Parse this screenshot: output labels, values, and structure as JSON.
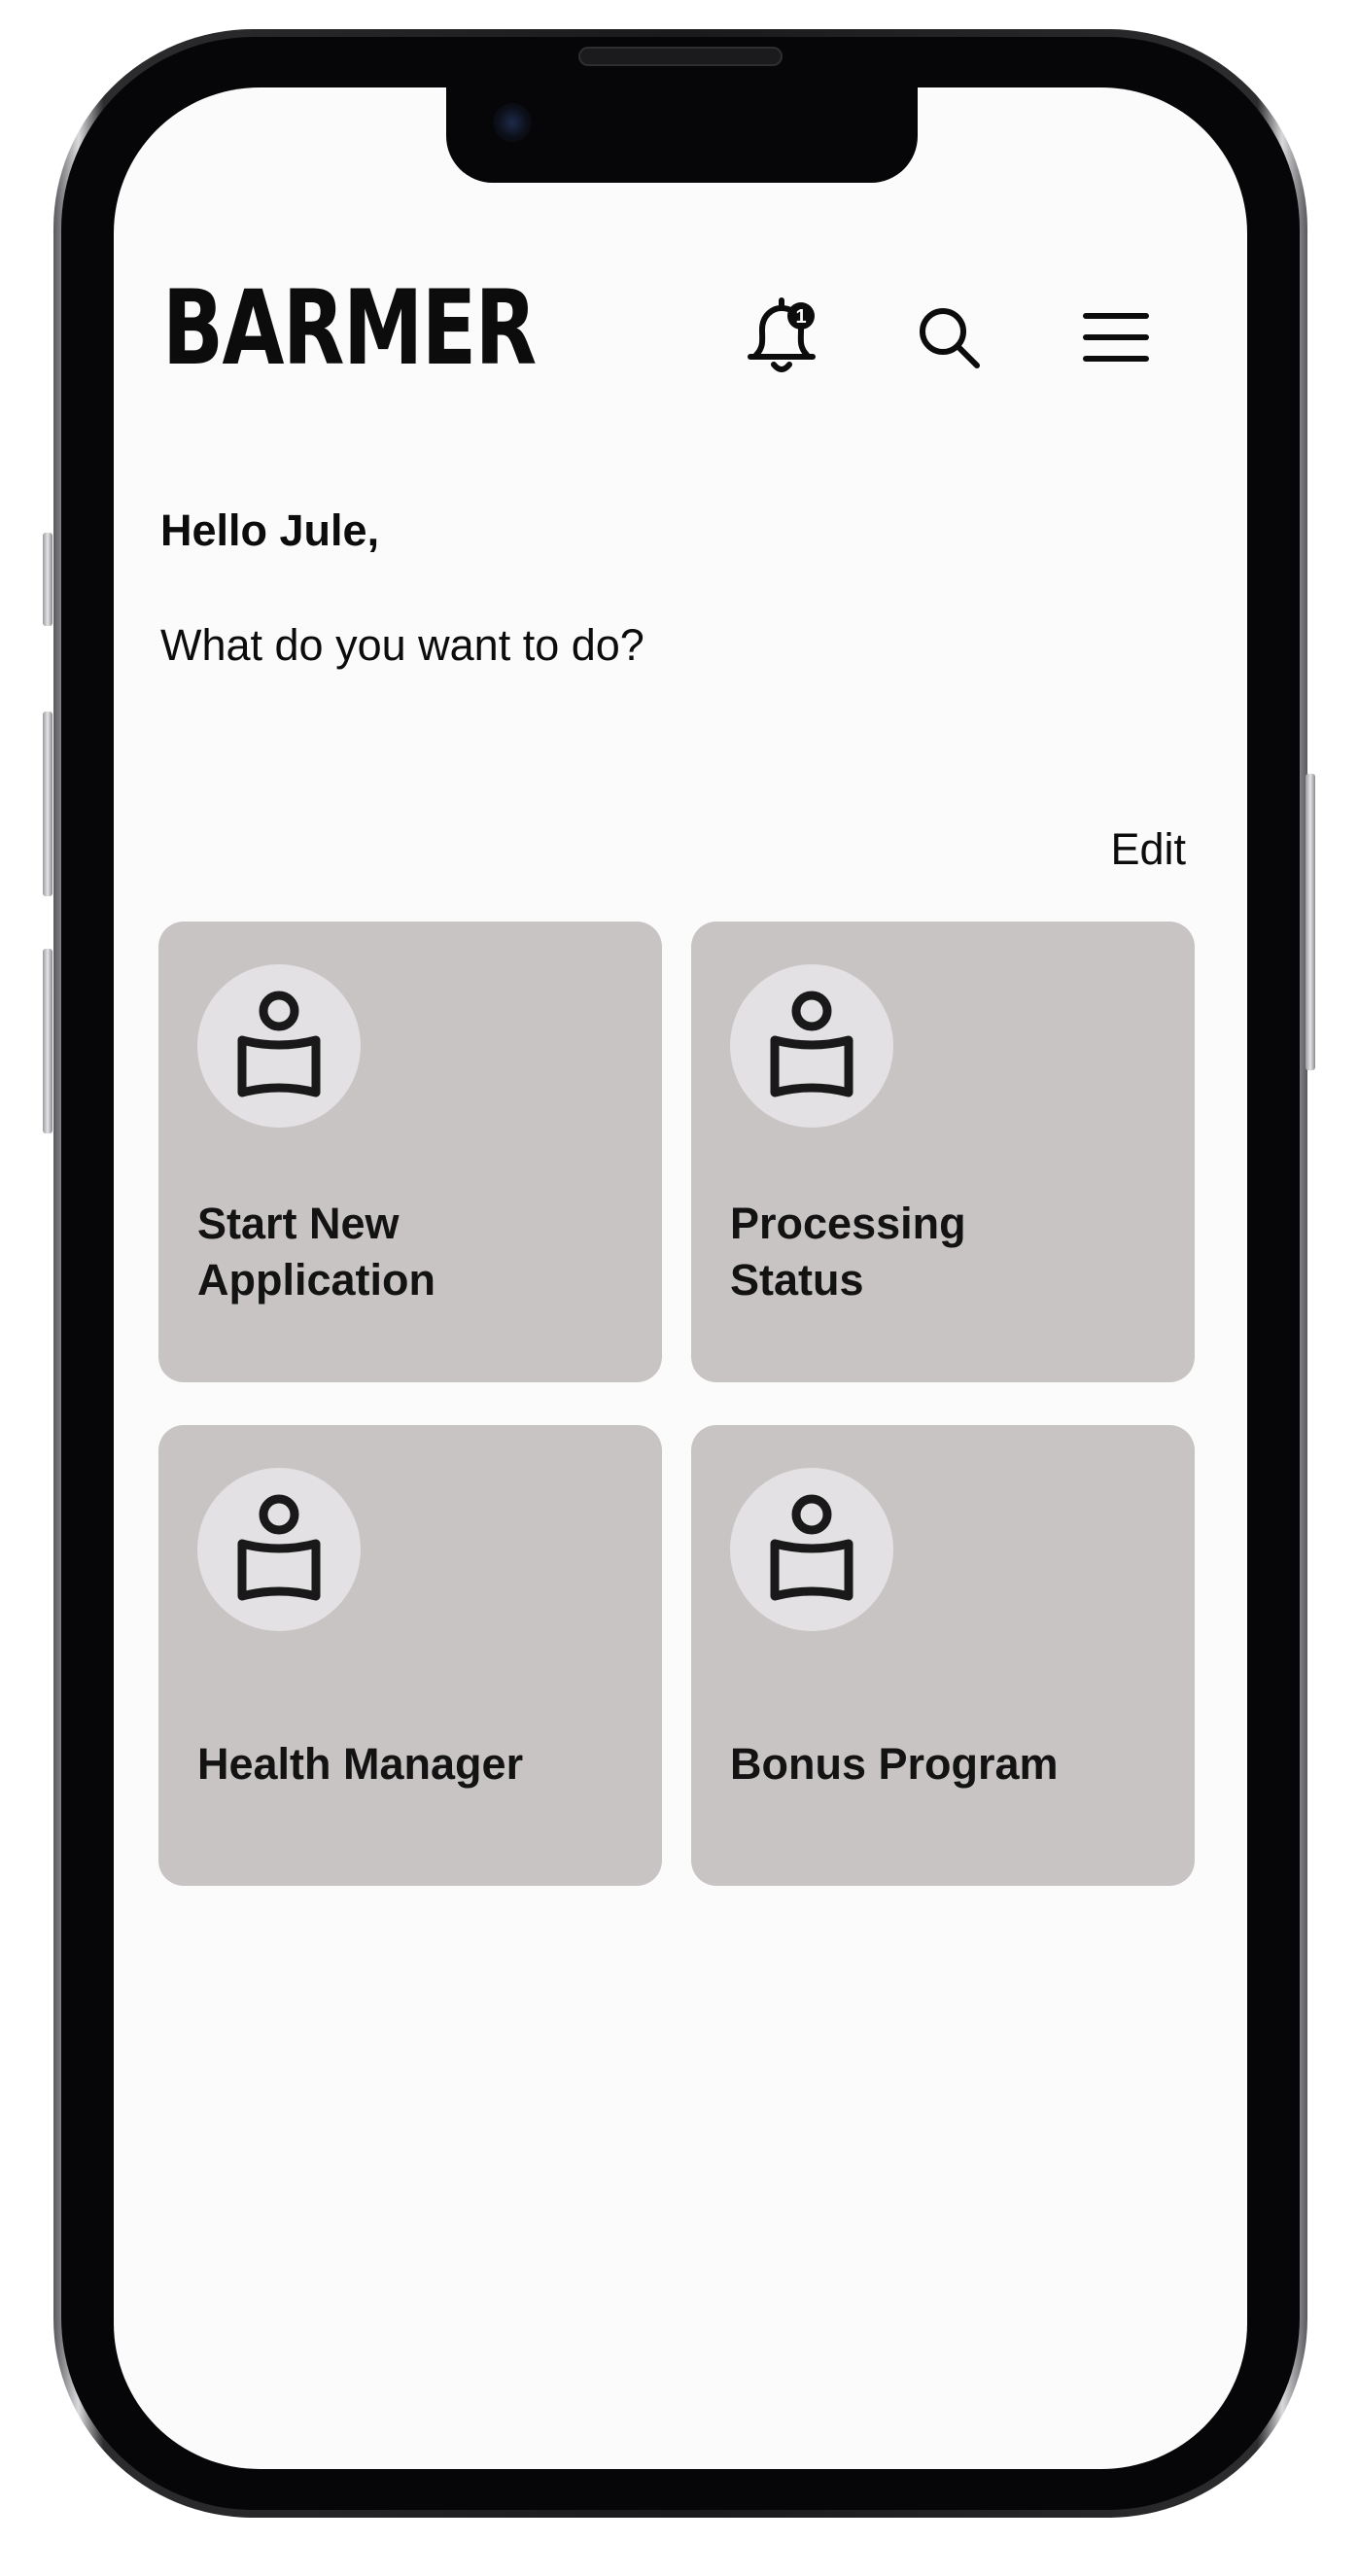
{
  "header": {
    "brand": "BARMER",
    "icons": [
      "notification-bell-icon",
      "search-icon",
      "hamburger-menu-icon"
    ],
    "notification_badge": "1"
  },
  "main": {
    "greeting": "Hello Jule,",
    "question": "What do you want to do?",
    "edit_label": "Edit",
    "tiles": [
      {
        "label": "Start New\nApplication",
        "icon": "id-card-person-icon"
      },
      {
        "label": "Processing\nStatus",
        "icon": "id-card-person-icon"
      },
      {
        "label": "Health Manager",
        "icon": "id-card-person-icon"
      },
      {
        "label": "Bonus Program",
        "icon": "id-card-person-icon"
      }
    ]
  },
  "colors": {
    "screen_background": "#fcfbfc",
    "tile_background": "#c9c4c4",
    "tile_icon_circle": "#e3e1e3",
    "text": "#0d0c0d",
    "device_frame": "#060507"
  }
}
